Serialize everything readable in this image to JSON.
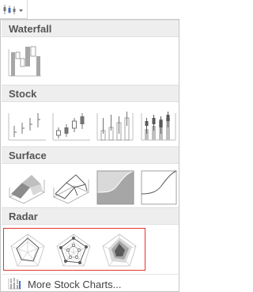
{
  "ribbon_button": {
    "icon": "stock-chart-icon",
    "dropdown_icon": "caret-down-icon"
  },
  "sections": {
    "waterfall": {
      "title": "Waterfall"
    },
    "stock": {
      "title": "Stock"
    },
    "surface": {
      "title": "Surface"
    },
    "radar": {
      "title": "Radar"
    }
  },
  "thumbnails": {
    "waterfall": [
      "waterfall-chart-icon"
    ],
    "stock": [
      "high-low-close-icon",
      "open-high-low-close-icon",
      "volume-high-low-close-icon",
      "volume-open-high-low-close-icon"
    ],
    "surface": [
      "3d-surface-icon",
      "wireframe-3d-surface-icon",
      "contour-icon",
      "wireframe-contour-icon"
    ],
    "radar": [
      "radar-icon",
      "radar-with-markers-icon",
      "filled-radar-icon"
    ]
  },
  "colors": {
    "selection": "#e3342f",
    "accent_gray": "#a6a6a6",
    "dark": "#595959"
  },
  "footer": {
    "label": "More Stock Charts..."
  }
}
